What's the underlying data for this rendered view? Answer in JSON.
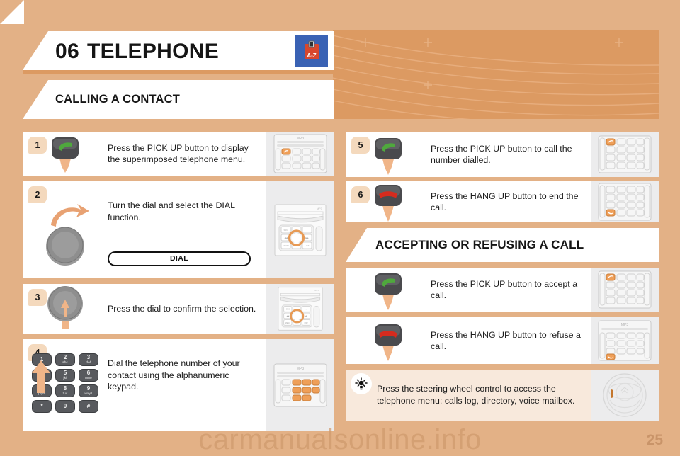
{
  "header": {
    "chapter_number": "06",
    "chapter_title": "TELEPHONE",
    "icon": "directory-az-icon",
    "icon_label": "A-Z"
  },
  "sections": {
    "calling": "CALLING A CONTACT",
    "accepting": "ACCEPTING OR REFUSING A CALL"
  },
  "steps": [
    {
      "number": "1",
      "text": "Press the PICK UP button to display the superimposed telephone menu.",
      "visual": "pickup-button",
      "thumb": "radio-keypad-pickup"
    },
    {
      "number": "2",
      "text": "Turn the dial and select the DIAL function.",
      "visual": "rotate-dial",
      "thumb": "radio-dial-unit",
      "menu_item": "DIAL"
    },
    {
      "number": "3",
      "text": "Press the dial to confirm the selection.",
      "visual": "press-dial",
      "thumb": "radio-dial-unit"
    },
    {
      "number": "4",
      "text": "Dial the telephone number of your contact using the alphanumeric keypad.",
      "visual": "alphanumeric-keypad",
      "thumb": "radio-keypad-numbers"
    },
    {
      "number": "5",
      "text": "Press the PICK UP button to call the number dialled.",
      "visual": "pickup-button",
      "thumb": "radio-keypad-pickup"
    },
    {
      "number": "6",
      "text": "Press the HANG UP button to end the call.",
      "visual": "hangup-button",
      "thumb": "radio-keypad-hangup"
    },
    {
      "number": "",
      "text": "Press the PICK UP button to accept a call.",
      "visual": "pickup-button",
      "thumb": "radio-keypad-pickup"
    },
    {
      "number": "",
      "text": "Press the HANG UP button to refuse a call.",
      "visual": "hangup-button",
      "thumb": "radio-keypad-hangup"
    }
  ],
  "tip": {
    "icon": "lightbulb-icon",
    "text": "Press the steering wheel control to access the telephone menu: calls log, directory, voice mailbox.",
    "thumb": "steering-wheel"
  },
  "keypad": {
    "keys": [
      {
        "digit": "1",
        "letters": ""
      },
      {
        "digit": "2",
        "letters": "abc"
      },
      {
        "digit": "3",
        "letters": "def"
      },
      {
        "digit": "4",
        "letters": "ghi"
      },
      {
        "digit": "5",
        "letters": "jkl"
      },
      {
        "digit": "6",
        "letters": "mno"
      },
      {
        "digit": "7",
        "letters": "pqrs"
      },
      {
        "digit": "8",
        "letters": "tuv"
      },
      {
        "digit": "9",
        "letters": "wxyz"
      },
      {
        "digit": "*",
        "letters": ""
      },
      {
        "digit": "0",
        "letters": ""
      },
      {
        "digit": "#",
        "letters": ""
      }
    ]
  },
  "radio_thumb": {
    "label_mp3": "MP3",
    "buttons": [
      "SRC",
      "MENU",
      "LIST"
    ]
  },
  "footer": {
    "watermark": "carmanualsonline.info",
    "page_number": "25"
  },
  "colors": {
    "page_bg": "#e3b186",
    "band": "#dc9a62",
    "card_bg": "#ffffff",
    "badge_bg": "#f4d9bd",
    "tip_bg": "#f8e9dc",
    "thumb_bg": "#ececed",
    "accent_green": "#4fa83d",
    "accent_red": "#d52b1e",
    "arrow": "#f0b588",
    "button_dark": "#4a4a4d",
    "icon_blue": "#3a62b4",
    "icon_red": "#d8472d"
  }
}
